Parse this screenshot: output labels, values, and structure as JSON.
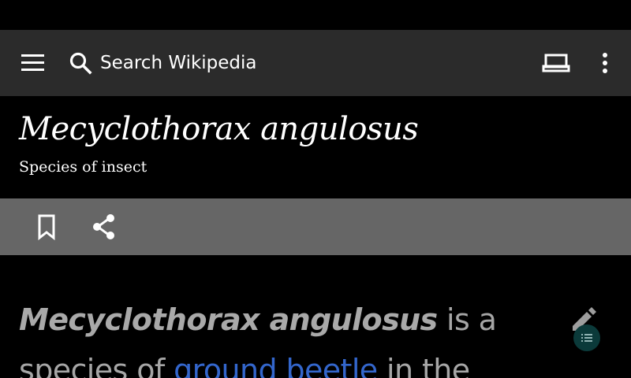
{
  "toolbar": {
    "search_placeholder": "Search Wikipedia"
  },
  "article": {
    "title": "Mecyclothorax angulosus",
    "description": "Species of insect",
    "lead": {
      "bold_title": "Mecyclothorax angulosus",
      "text_1": " is a species of ",
      "link_1": "ground beetle",
      "text_2": " in the"
    }
  },
  "colors": {
    "toolbar_bg": "#2b2b2b",
    "action_bar_bg": "#666666",
    "link": "#3366cc",
    "body_text": "#a6a6a6"
  },
  "icons": [
    "menu-icon",
    "search-icon",
    "tabs-icon",
    "overflow-icon",
    "bookmark-icon",
    "share-icon",
    "edit-icon",
    "toc-icon"
  ]
}
